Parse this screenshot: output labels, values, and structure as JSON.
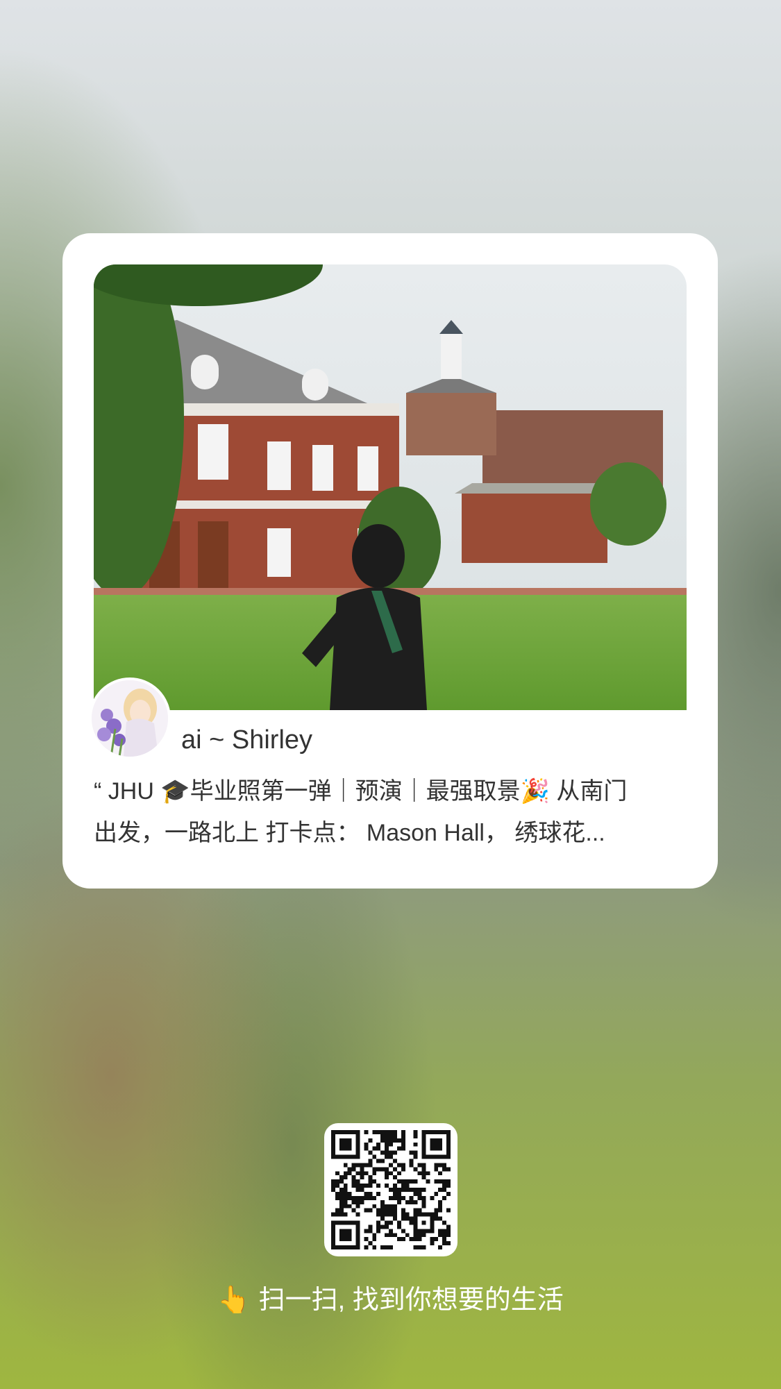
{
  "card": {
    "photo_icon": "campus-photo",
    "avatar_icon": "avatar-illustration",
    "username": "ai ~ Shirley",
    "description_line1": "“ JHU 🎓毕业照第一弹｜预演｜最强取景🎉 从南门",
    "description_line2": "出发，一路北上 打卡点： Mason Hall， 绣球花..."
  },
  "qr": {
    "icon": "qr-code"
  },
  "hint": {
    "icon": "pointing-hand-icon",
    "emoji": "👆",
    "text": "扫一扫, 找到你想要的生活"
  }
}
